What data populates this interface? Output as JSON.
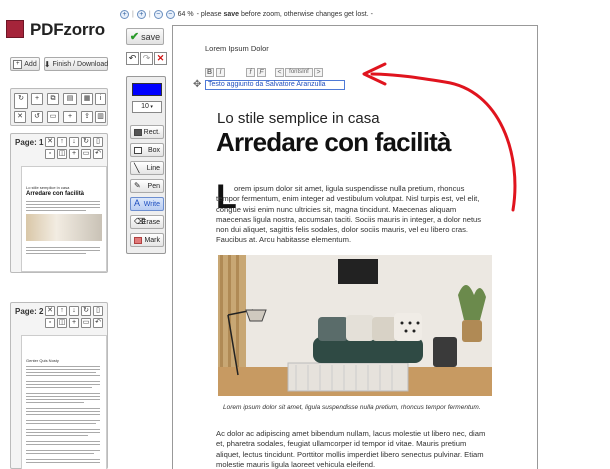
{
  "app": {
    "name": "PDFzorro"
  },
  "left": {
    "add_label": "Add",
    "finish_label": "Finish / Download",
    "tools": [
      "all",
      "add",
      "paste",
      "file info",
      "export",
      "add"
    ],
    "pages": [
      {
        "label": "Page: 1",
        "thumb_title_small": "Lo stile semplice in casa",
        "thumb_title": "Arredare con facilità"
      },
      {
        "label": "Page: 2",
        "thumb_title_small": "Genter Quis Nosty"
      }
    ]
  },
  "toolbar": {
    "save_label": "save",
    "zoom_level": "64 %",
    "zoom_prefix": " - please ",
    "zoom_bold": "save",
    "zoom_suffix": " before zoom, otherwise changes get lost. -",
    "color_hex": "#0000ff",
    "font_size": "10",
    "tools": [
      "Rect.",
      "Box",
      "Line",
      "Pen",
      "Write",
      "Erase",
      "Mark"
    ]
  },
  "document": {
    "header": "Lorem Ipsum Dolor",
    "format_bar": {
      "bold": "B",
      "italic": "I",
      "font": "fontsInf"
    },
    "edit_text": "Testo aggiunto da Salvatore Aranzulla",
    "subtitle": "Lo stile semplice in casa",
    "title": "Arredare con facilità",
    "drop_cap": "L",
    "para1": "orem ipsum dolor sit amet, ligula suspendisse nulla pretium, rhoncus tempor fermentum, enim integer ad vestibulum volutpat. Nisl turpis est, vel elit, congue wisi enim nunc ultricies sit, magna tincidunt. Maecenas aliquam maecenas ligula nostra, accumsan taciti. Sociis mauris in integer, a dolor netus non dui aliquet, sagittis felis sodales, dolor sociis mauris, vel eu libero cras. Faucibus at. Arcu habitasse elementum.",
    "caption": "Lorem ipsum dolor sit amet, ligula suspendisse nulla pretium, rhoncus tempor fermentum.",
    "para2": "Ac dolor ac adipiscing amet bibendum nullam, lacus molestie ut libero nec, diam et, pharetra sodales, feugiat ullamcorper id tempor id vitae. Mauris pretium aliquet, lectus tincidunt. Porttitor mollis imperdiet libero senectus pulvinar. Etiam molestie mauris ligula laoreet vehicula eleifend."
  },
  "colors": {
    "brand": "#a5243a",
    "arrow": "#e0141e",
    "edit_border": "#4f7ad6"
  }
}
